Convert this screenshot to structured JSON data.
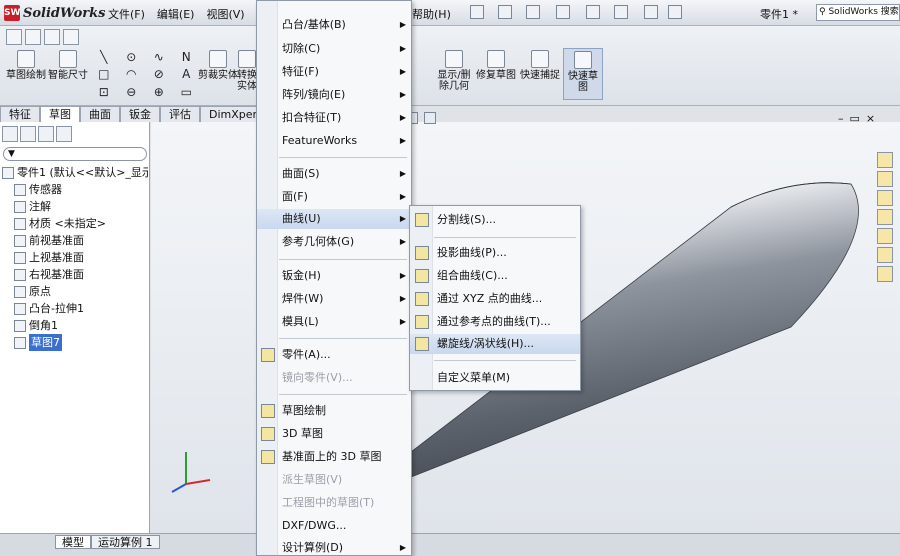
{
  "app": {
    "brand": "SolidWorks",
    "doc_title": "零件1 *",
    "search_placeholder": "SolidWorks 搜索"
  },
  "menubar": {
    "items": [
      "文件(F)",
      "编辑(E)",
      "视图(V)"
    ],
    "right_item": "帮助(H)"
  },
  "command_manager": {
    "buttons": [
      {
        "label": "草图绘制",
        "active": false
      },
      {
        "label": "智能尺寸",
        "active": false
      },
      {
        "label": "剪裁实体",
        "active": false
      },
      {
        "label": "转换实体",
        "active": false
      },
      {
        "label": "显示/删除几何",
        "active": false
      },
      {
        "label": "修复草图",
        "active": false
      },
      {
        "label": "快速捕捉",
        "active": false
      },
      {
        "label": "快速草图",
        "active": true
      }
    ],
    "sketch_tools": [
      "╲",
      "⊙",
      "∿",
      "N",
      "□",
      "◠",
      "⊘",
      "A",
      "⊡",
      "⊖",
      "⊕",
      "▭"
    ]
  },
  "tabs": [
    "特征",
    "草图",
    "曲面",
    "钣金",
    "评估",
    "DimXpert"
  ],
  "selected_tab": "草图",
  "feature_tree": {
    "filter_icon": "funnel-icon",
    "root": "零件1 (默认<<默认>_显示",
    "items": [
      {
        "label": "传感器",
        "icon": "sensor-icon"
      },
      {
        "label": "注解",
        "icon": "annotation-icon"
      },
      {
        "label": "材质 <未指定>",
        "icon": "material-icon"
      },
      {
        "label": "前视基准面",
        "icon": "plane-icon"
      },
      {
        "label": "上视基准面",
        "icon": "plane-icon"
      },
      {
        "label": "右视基准面",
        "icon": "plane-icon"
      },
      {
        "label": "原点",
        "icon": "origin-icon"
      },
      {
        "label": "凸台-拉伸1",
        "icon": "extrude-icon"
      },
      {
        "label": "倒角1",
        "icon": "chamfer-icon"
      },
      {
        "label": "草图7",
        "icon": "sketch-icon",
        "selected": true
      }
    ]
  },
  "menu_insert": {
    "items": [
      {
        "label": "凸台/基体(B)",
        "submenu": true
      },
      {
        "label": "切除(C)",
        "submenu": true
      },
      {
        "label": "特征(F)",
        "submenu": true
      },
      {
        "label": "阵列/镜向(E)",
        "submenu": true
      },
      {
        "label": "扣合特征(T)",
        "submenu": true
      },
      {
        "label": "FeatureWorks",
        "submenu": true
      },
      {
        "label": "曲面(S)",
        "submenu": true
      },
      {
        "label": "面(F)",
        "submenu": true
      },
      {
        "label": "曲线(U)",
        "submenu": true,
        "highlighted": true
      },
      {
        "label": "参考几何体(G)",
        "submenu": true
      },
      {
        "label": "钣金(H)",
        "submenu": true
      },
      {
        "label": "焊件(W)",
        "submenu": true
      },
      {
        "label": "模具(L)",
        "submenu": true
      },
      {
        "label": "零件(A)...",
        "icon": "part-icon"
      },
      {
        "label": "镜向零件(V)...",
        "disabled": true
      },
      {
        "label": "草图绘制",
        "icon": "sketch-icon"
      },
      {
        "label": "3D 草图",
        "icon": "3d-sketch-icon"
      },
      {
        "label": "基准面上的 3D 草图",
        "icon": "3d-sketch-plane-icon"
      },
      {
        "label": "派生草图(V)",
        "disabled": true
      },
      {
        "label": "工程图中的草图(T)",
        "disabled": true
      },
      {
        "label": "DXF/DWG..."
      },
      {
        "label": "设计算例(D)",
        "submenu": true
      }
    ]
  },
  "menu_curve": {
    "items": [
      {
        "label": "分割线(S)...",
        "icon": "split-line-icon"
      },
      {
        "label": "投影曲线(P)...",
        "icon": "projected-curve-icon"
      },
      {
        "label": "组合曲线(C)...",
        "icon": "composite-curve-icon"
      },
      {
        "label": "通过 XYZ 点的曲线...",
        "icon": "xyz-curve-icon"
      },
      {
        "label": "通过参考点的曲线(T)...",
        "icon": "ref-point-curve-icon"
      },
      {
        "label": "螺旋线/涡状线(H)...",
        "icon": "helix-icon",
        "highlighted": true
      },
      {
        "label": "自定义菜单(M)"
      }
    ]
  },
  "status_tabs": [
    "模型",
    "运动算例 1"
  ],
  "status_selected": "模型",
  "colors": {
    "accent": "#3a6fd0",
    "menu_highlight": "#c9d8ee",
    "disabled": "#9aa0a8"
  }
}
